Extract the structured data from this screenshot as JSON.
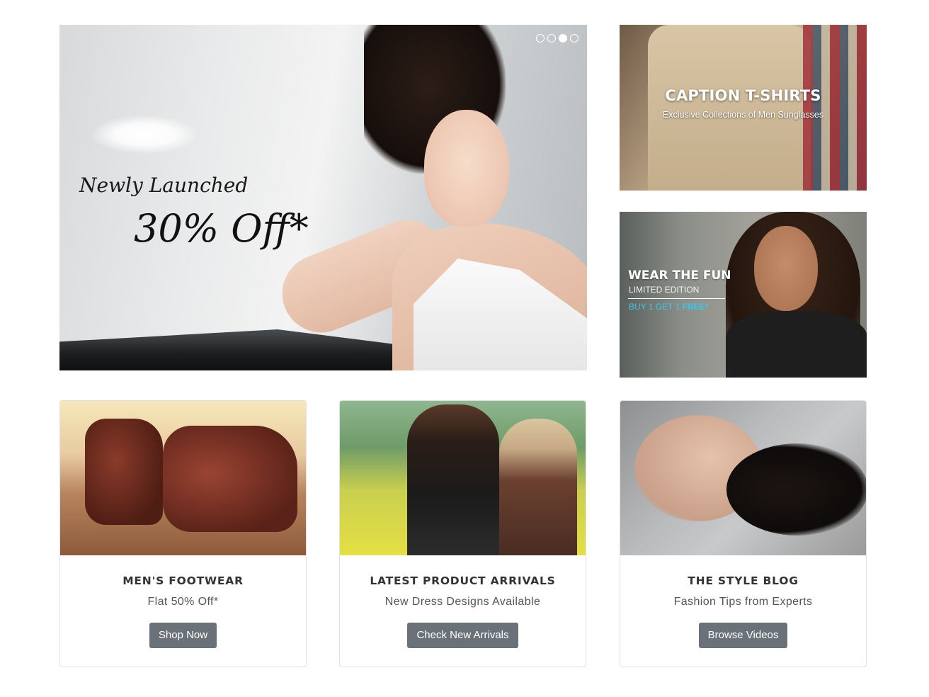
{
  "hero": {
    "tagline": "Newly Launched",
    "offer": "30% Off*",
    "slider": {
      "count": 4,
      "active_index": 2
    }
  },
  "side_banners": [
    {
      "title": "CAPTION T-SHIRTS",
      "subtitle": "Exclusive Collections of Men Sunglasses"
    },
    {
      "title": "WEAR THE FUN",
      "edition": "LIMITED EDITION",
      "offer_prefix": "BUY 1 GET 1",
      "offer_highlight": "FREE*"
    }
  ],
  "cards": [
    {
      "title": "MEN'S FOOTWEAR",
      "subtitle": "Flat 50% Off*",
      "button": "Shop Now"
    },
    {
      "title": "LATEST PRODUCT ARRIVALS",
      "subtitle": "New Dress Designs Available",
      "button": "Check New Arrivals"
    },
    {
      "title": "THE STYLE BLOG",
      "subtitle": "Fashion Tips from Experts",
      "button": "Browse Videos"
    }
  ],
  "colors": {
    "button_bg": "#6b7178",
    "accent_cyan": "#3cc6e8",
    "card_border": "#e2e2e2"
  }
}
